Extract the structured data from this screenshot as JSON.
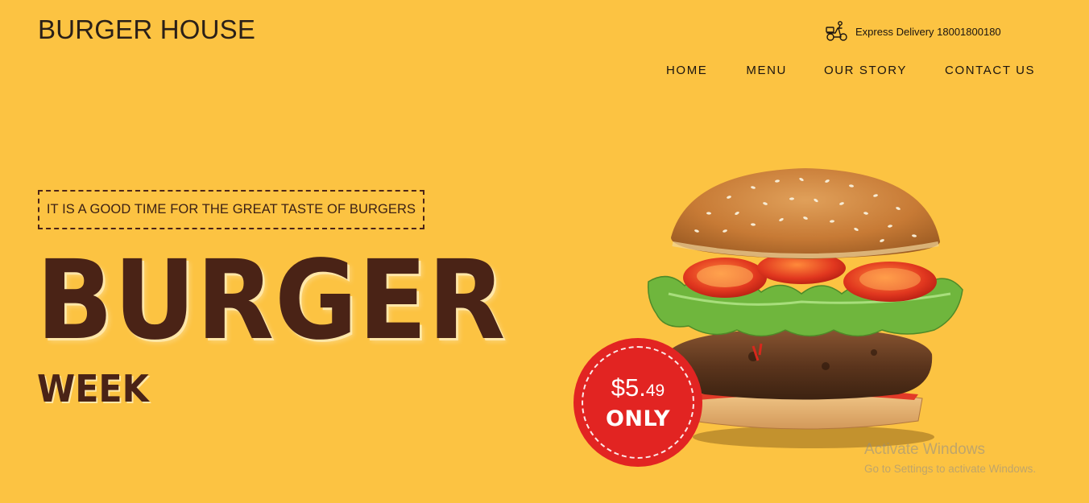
{
  "header": {
    "brand": "BURGER HOUSE",
    "delivery": {
      "icon": "scooter-delivery-icon",
      "text": "Express Delivery 18001800180"
    }
  },
  "nav": {
    "items": [
      {
        "label": "HOME"
      },
      {
        "label": "MENU"
      },
      {
        "label": "OUR STORY"
      },
      {
        "label": "CONTACT US"
      }
    ]
  },
  "hero": {
    "tagline": "IT IS A GOOD TIME FOR THE GREAT TASTE OF BURGERS",
    "headline_main": "BURGER",
    "headline_sub": "WEEK",
    "price": {
      "amount": "$5.",
      "cents": "49",
      "suffix": "ONLY"
    }
  },
  "os_overlay": {
    "title": "Activate Windows",
    "subtitle": "Go to Settings to activate Windows."
  },
  "colors": {
    "background": "#fcc342",
    "headline": "#4a2316",
    "badge": "#e22422"
  }
}
